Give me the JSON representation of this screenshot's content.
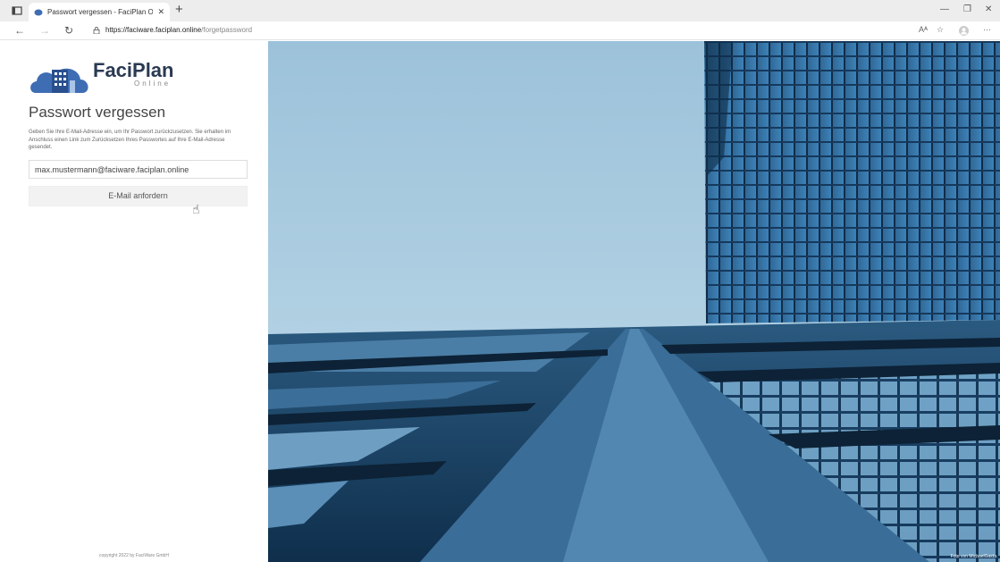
{
  "browser": {
    "tab_title": "Passwort vergessen - FaciPlan O",
    "url_host": "https://faciware.faciplan.online",
    "url_path": "/forgetpassword",
    "icons": [
      "sidebar-icon",
      "tab-favicon",
      "close-icon",
      "new-tab-icon",
      "back-icon",
      "forward-icon",
      "reload-icon",
      "lock-icon",
      "read-aloud-icon",
      "favorites-icon",
      "profile-icon",
      "more-icon"
    ]
  },
  "brand": {
    "name": "FaciPlan",
    "sub": "Online"
  },
  "form": {
    "title": "Passwort vergessen",
    "description": "Geben Sie Ihre E-Mail-Adresse ein, um Ihr Passwort zurückzusetzen. Sie erhalten im Anschluss einen Link zum Zurücksetzen Ihres Passwortes auf Ihre E-Mail-Adresse gesendet.",
    "email_value": "max.mustermann@faciware.faciplan.online",
    "submit_label": "E-Mail anfordern"
  },
  "footer": {
    "copyright": "copyright 2022 by FaciWare GmbH"
  },
  "photo": {
    "credit": "Foto von MichaelGaida"
  },
  "colors": {
    "brand_blue": "#3f6db4",
    "sky": "#a9cbe0",
    "glass": "#1d4f7a"
  }
}
